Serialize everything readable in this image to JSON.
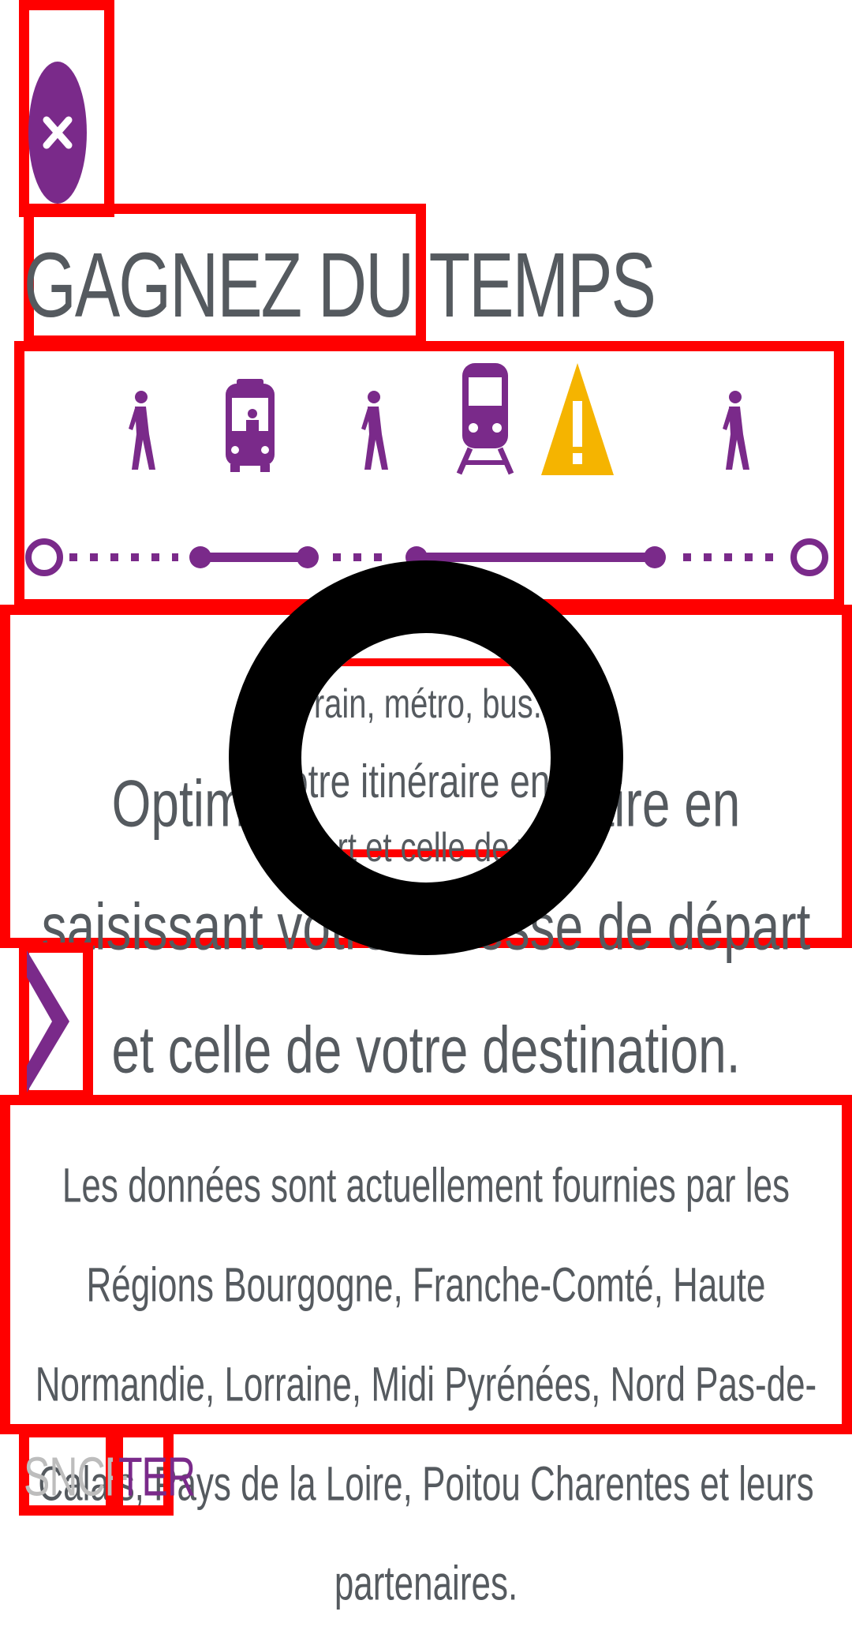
{
  "colors": {
    "accent": "#7a2a8a",
    "warning": "#f5b400",
    "text": "#555a5f",
    "highlight": "#ff0000"
  },
  "title": "GAGNEZ DU TEMPS",
  "journey": {
    "icons": [
      "walk-icon",
      "bus-icon",
      "walk-icon",
      "train-icon",
      "warning-icon",
      "walk-icon"
    ]
  },
  "description": {
    "text": "Optimisez votre itinéraire en saisissant votre adresse de départ et celle de votre destination.",
    "magnifier": {
      "line1": "Train, métro, bus...",
      "line2": "votre itinéraire en saisis",
      "line3": "épart et celle de votr"
    }
  },
  "info": "Les données sont actuellement fournies par les Régions Bourgogne, Franche-Comté, Haute Normandie, Lorraine, Midi Pyrénées, Nord Pas-de-Calais, Pays de la Loire, Poitou Charentes et leurs partenaires.",
  "brand": {
    "sncf": "SNCF",
    "ter": "TER"
  }
}
